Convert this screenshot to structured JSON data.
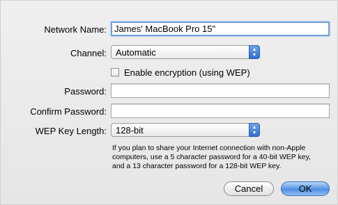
{
  "form": {
    "network_name_label": "Network Name:",
    "network_name_value": "James' MacBook Pro 15\"",
    "channel_label": "Channel:",
    "channel_value": "Automatic",
    "encryption_label": "Enable encryption (using WEP)",
    "encryption_checked": false,
    "password_label": "Password:",
    "password_value": "",
    "confirm_password_label": "Confirm Password:",
    "confirm_password_value": "",
    "wep_key_length_label": "WEP Key Length:",
    "wep_key_length_value": "128-bit",
    "help_lines": [
      "If you plan to share your Internet connection with non-Apple",
      "computers, use a 5 character password for a 40-bit WEP key,",
      "and a 13 character password for a 128-bit WEP key."
    ]
  },
  "buttons": {
    "cancel_label": "Cancel",
    "ok_label": "OK"
  },
  "colors": {
    "focus_ring": "#6f9fdc",
    "default_button": "#5c9be8",
    "popup_arrows": "#2e6fd1"
  }
}
